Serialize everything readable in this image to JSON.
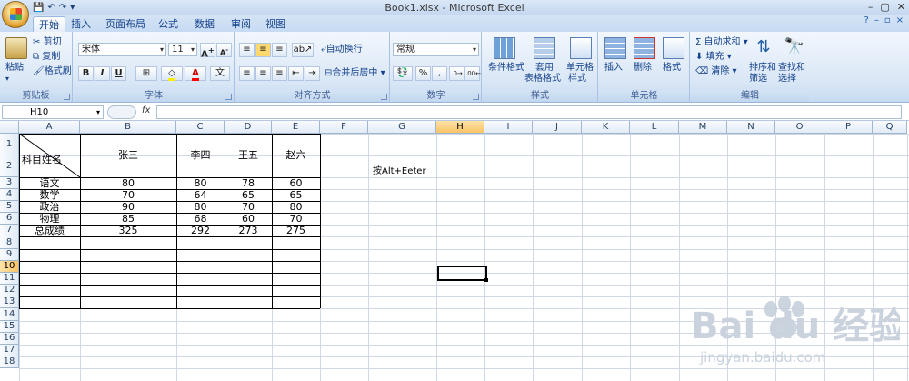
{
  "window": {
    "title": "Book1.xlsx - Microsoft Excel"
  },
  "tabs": [
    "开始",
    "插入",
    "页面布局",
    "公式",
    "数据",
    "审阅",
    "视图"
  ],
  "active_tab": "开始",
  "ribbon": {
    "clipboard": {
      "label": "剪贴板",
      "paste": "粘贴",
      "cut": "剪切",
      "copy": "复制",
      "format_painter": "格式刷"
    },
    "font": {
      "label": "字体",
      "font_name": "宋体",
      "font_size": "11",
      "bold": "B",
      "italic": "I",
      "underline": "U"
    },
    "alignment": {
      "label": "对齐方式",
      "wrap_text": "自动换行",
      "merge_center": "合并后居中"
    },
    "number": {
      "label": "数字",
      "format": "常规",
      "percent": "%",
      "comma": ","
    },
    "styles": {
      "label": "样式",
      "conditional": "条件格式",
      "table": "套用",
      "table2": "表格格式",
      "cell_styles": "单元格",
      "cell_styles2": "样式"
    },
    "cells": {
      "label": "单元格",
      "insert": "插入",
      "delete": "删除",
      "format": "格式"
    },
    "editing": {
      "label": "编辑",
      "autosum": "自动求和",
      "fill": "填充",
      "clear": "清除",
      "sort": "排序和",
      "sort2": "筛选",
      "find": "查找和",
      "find2": "选择"
    }
  },
  "formula_bar": {
    "name_box": "H10",
    "fx": "fx",
    "formula": ""
  },
  "columns": [
    "A",
    "B",
    "C",
    "D",
    "E",
    "F",
    "G",
    "H",
    "I",
    "J",
    "K",
    "L",
    "M",
    "N",
    "O",
    "P",
    "Q"
  ],
  "rows": [
    "1",
    "2",
    "3",
    "4",
    "5",
    "6",
    "7",
    "8",
    "9",
    "10",
    "11",
    "12",
    "13",
    "14",
    "15",
    "16",
    "17",
    "18"
  ],
  "selected": {
    "column": "H",
    "row": "10"
  },
  "table": {
    "header_corner": "科目姓名",
    "names": [
      "张三",
      "李四",
      "王五",
      "赵六"
    ],
    "data": [
      {
        "subject": "语文",
        "values": [
          "80",
          "80",
          "78",
          "60"
        ]
      },
      {
        "subject": "数学",
        "values": [
          "70",
          "64",
          "65",
          "65"
        ]
      },
      {
        "subject": "政治",
        "values": [
          "90",
          "80",
          "70",
          "80"
        ]
      },
      {
        "subject": "物理",
        "values": [
          "85",
          "68",
          "60",
          "70"
        ]
      },
      {
        "subject": "总成绩",
        "values": [
          "325",
          "292",
          "273",
          "275"
        ]
      }
    ]
  },
  "note": "按Alt+Eeter",
  "watermark": {
    "brand": "Bai du 经验",
    "url": "jingyan.baidu.com"
  }
}
